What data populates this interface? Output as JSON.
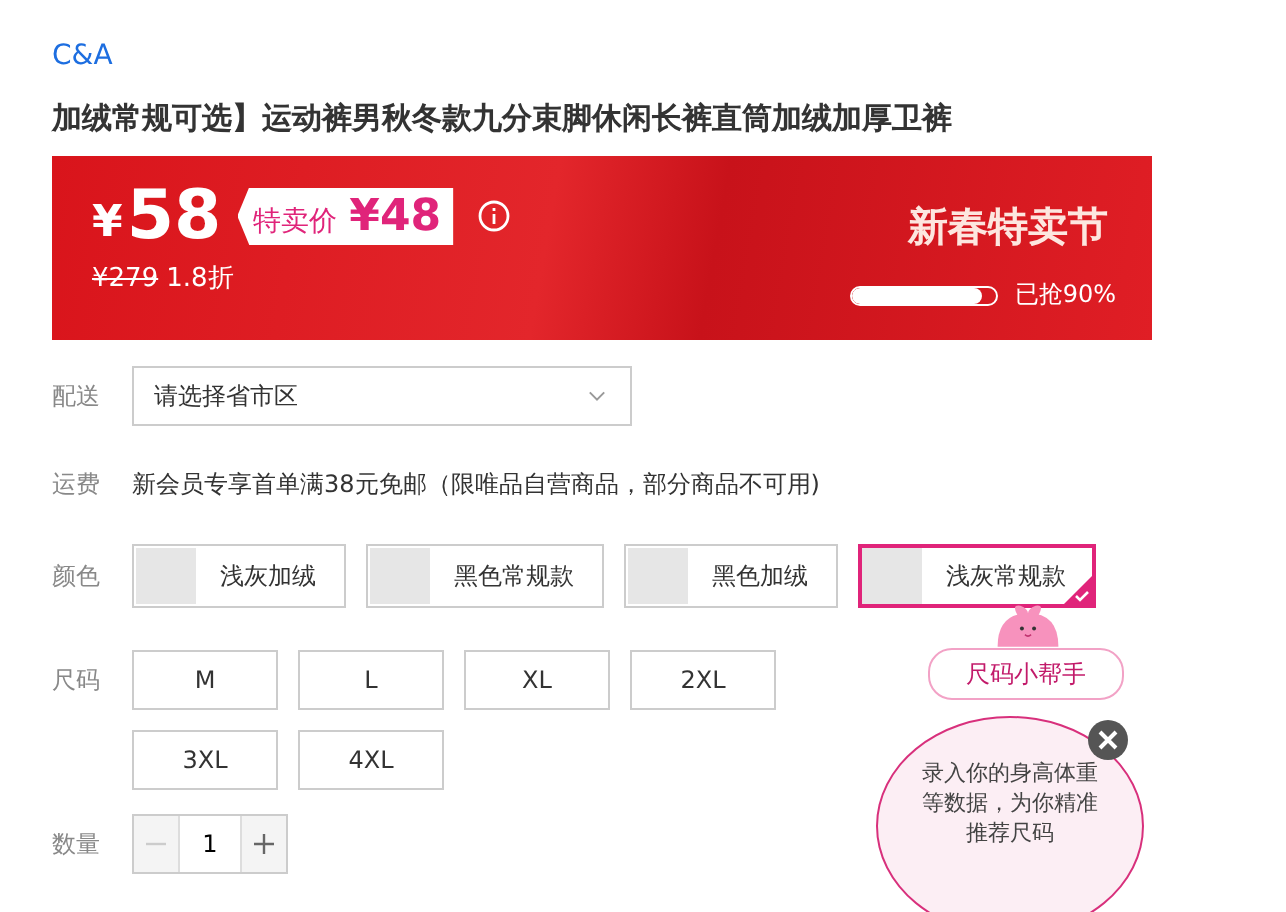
{
  "brand": "C&A",
  "title": "加绒常规可选】运动裤男秋冬款九分束脚休闲长裤直筒加绒加厚卫裤",
  "price": {
    "currency": "¥",
    "value": "58",
    "special_label": "特卖价",
    "special_price": "¥48",
    "original": "¥279",
    "discount": "1.8折",
    "promo_title": "新春特卖节",
    "sold": {
      "level": 0.9
    },
    "sold_text": "已抢90%"
  },
  "delivery": {
    "label": "配送",
    "placeholder": "请选择省市区"
  },
  "shipping": {
    "label": "运费",
    "text": "新会员专享首单满38元免邮（限唯品自营商品，部分商品不可用)"
  },
  "colors": {
    "label": "颜色",
    "options": [
      {
        "name": "浅灰加绒",
        "selected": false
      },
      {
        "name": "黑色常规款",
        "selected": false
      },
      {
        "name": "黑色加绒",
        "selected": false
      },
      {
        "name": "浅灰常规款",
        "selected": true
      }
    ]
  },
  "sizes": {
    "label": "尺码",
    "options": [
      {
        "name": "M",
        "selected": false
      },
      {
        "name": "L",
        "selected": false
      },
      {
        "name": "XL",
        "selected": false
      },
      {
        "name": "2XL",
        "selected": false
      },
      {
        "name": "3XL",
        "selected": false
      },
      {
        "name": "4XL",
        "selected": false
      }
    ]
  },
  "quantity": {
    "label": "数量",
    "value": "1",
    "minus_disabled": true
  },
  "helper": {
    "title": "尺码小帮手",
    "text": "录入你的身高体重等数据，为你精准推荐尺码"
  }
}
